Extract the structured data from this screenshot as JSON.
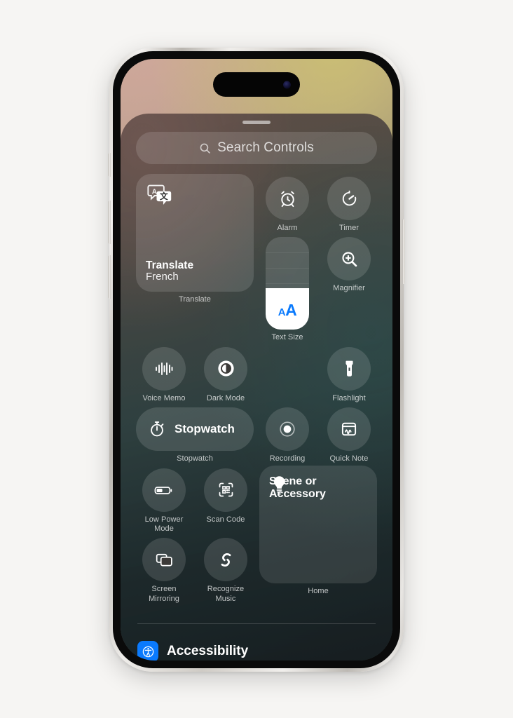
{
  "device": {
    "name": "iPhone",
    "dynamic_island": "dynamic-island",
    "buttons": [
      "action-button",
      "volume-up-button",
      "volume-down-button",
      "power-button"
    ]
  },
  "control_center": {
    "grabber": "drag-handle",
    "search": {
      "placeholder": "Search Controls",
      "icon": "search-icon",
      "value": ""
    },
    "controls": [
      {
        "id": "translate",
        "type": "large-tile",
        "title": "Translate",
        "subtitle": "French",
        "caption": "Translate",
        "icon": "translate-icon"
      },
      {
        "id": "alarm",
        "type": "circle",
        "caption": "Alarm",
        "icon": "alarm-clock-icon"
      },
      {
        "id": "timer",
        "type": "circle",
        "caption": "Timer",
        "icon": "timer-icon"
      },
      {
        "id": "text-size",
        "type": "vertical-slider",
        "caption": "Text Size",
        "icon": "text-size-aa-icon",
        "value_percent": 45,
        "small_a": "A",
        "big_a": "A",
        "accent": "#0a7afd"
      },
      {
        "id": "magnifier",
        "type": "circle",
        "caption": "Magnifier",
        "icon": "magnifier-icon"
      },
      {
        "id": "voice-memo",
        "type": "circle",
        "caption": "Voice Memo",
        "icon": "waveform-icon"
      },
      {
        "id": "dark-mode",
        "type": "circle",
        "caption": "Dark Mode",
        "icon": "dark-mode-icon"
      },
      {
        "id": "flashlight",
        "type": "circle",
        "caption": "Flashlight",
        "icon": "flashlight-icon"
      },
      {
        "id": "stopwatch",
        "type": "pill",
        "label": "Stopwatch",
        "caption": "Stopwatch",
        "icon": "stopwatch-icon"
      },
      {
        "id": "recording",
        "type": "circle",
        "caption": "Recording",
        "icon": "record-icon"
      },
      {
        "id": "quick-note",
        "type": "circle",
        "caption": "Quick Note",
        "icon": "quick-note-icon"
      },
      {
        "id": "low-power-mode",
        "type": "circle",
        "caption": "Low Power\nMode",
        "caption_line1": "Low Power",
        "caption_line2": "Mode",
        "icon": "battery-icon"
      },
      {
        "id": "scan-code",
        "type": "circle",
        "caption": "Scan Code",
        "icon": "qr-scan-icon"
      },
      {
        "id": "home-scene",
        "type": "large-tile",
        "title_line1": "Scene or",
        "title_line2": "Accessory",
        "caption": "Home",
        "icon": "lightbulb-icon"
      },
      {
        "id": "screen-mirroring",
        "type": "circle",
        "caption_line1": "Screen",
        "caption_line2": "Mirroring",
        "icon": "screen-mirroring-icon"
      },
      {
        "id": "recognize-music",
        "type": "circle",
        "caption_line1": "Recognize",
        "caption_line2": "Music",
        "icon": "shazam-icon"
      }
    ],
    "accessibility_section": {
      "title": "Accessibility",
      "badge_icon": "accessibility-badge-icon",
      "badge_color": "#0a7afd",
      "items": [
        {
          "id": "accessibility-shortcut",
          "icon": "accessibility-person-icon"
        },
        {
          "id": "assistive-touch",
          "icon": "assistive-touch-icon"
        },
        {
          "id": "guided-access",
          "icon": "guided-access-lock-icon"
        },
        {
          "id": "live-speech-keyboard",
          "icon": "keyboard-speech-icon"
        }
      ]
    }
  }
}
